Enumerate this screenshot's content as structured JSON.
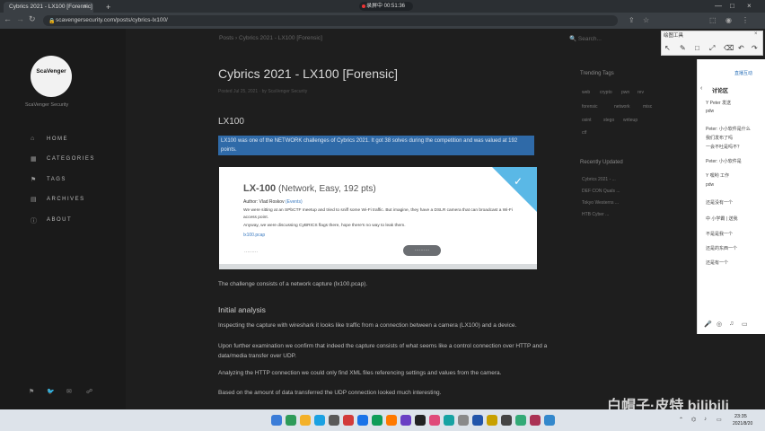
{
  "browser": {
    "tab_title": "Cybrics 2021 - LX100 [Forensic]",
    "tab_close": "×",
    "new_tab": "+",
    "recording": "录屏中 00:51:36",
    "url": "scavengersecurity.com/posts/cybrics-lx100/",
    "back": "←",
    "forward": "→",
    "reload": "↻",
    "lock": "🔒",
    "min": "—",
    "max": "□",
    "close": "×"
  },
  "site": {
    "logo_text": "ScaVenger",
    "tagline": "ScaVenger Security",
    "nav": [
      {
        "icon": "⌂",
        "label": "HOME"
      },
      {
        "icon": "▦",
        "label": "CATEGORIES"
      },
      {
        "icon": "⚑",
        "label": "TAGS"
      },
      {
        "icon": "▤",
        "label": "ARCHIVES"
      },
      {
        "icon": "ⓘ",
        "label": "ABOUT"
      }
    ],
    "social": [
      "⚑",
      "🐦",
      "✉",
      "☍"
    ]
  },
  "post": {
    "breadcrumb": "Posts › Cybrics 2021 - LX100 [Forensic]",
    "search_label": "🔍 Search...",
    "title": "Cybrics 2021 - LX100 [Forensic]",
    "meta": "Posted Jul 25, 2021 · by ScaVenger Security",
    "heading_lx100": "LX100",
    "intro": "LX100 was one of the NETWORK challenges of Cybrics 2021. It got 38 solves during the competition and was valued at 192 points.",
    "card": {
      "title_bold": "LX-100",
      "title_rest": "(Network, Easy, 192 pts)",
      "author_label": "Author: Vlad Roskov",
      "author_link": "(Events)",
      "desc1": "We were sitting at an SPbCTF meetup and tried to sniff some Wi-Fi traffic. But imagine, they have a DSLR camera that can broadcast a Wi-Fi access point.",
      "desc2": "Anyway, we were discussing CyBRICS flags there, hope there's no way to leak them.",
      "link": "lx100.pcap",
      "left_label": "  ·········",
      "button": "··········",
      "check": "✓"
    },
    "p_challenge": "The challenge consists of a network capture (lx100.pcap).",
    "heading_initial": "Initial analysis",
    "paragraphs": [
      "Inspecting the capture with wireshark it looks like traffic from a connection between a camera (LX100) and a device.",
      "Upon further examination we confirm that indeed the capture consists of what seems like a control connection over HTTP and a data/media transfer over UDP.",
      "Analyzing the HTTP connection we could only find XML files referencing settings and values from the camera.",
      "Based on the amount of data transferred the UDP connection looked much interesting."
    ]
  },
  "right_sidebar": {
    "trending_title": "Trending Tags",
    "tags": [
      "web",
      "crypto",
      "pwn",
      "rev",
      "forensic",
      "network",
      "misc",
      "osint",
      "stego",
      "writeup",
      "ctf"
    ],
    "recent_title": "Recently Updated",
    "recent": [
      "Cybrics 2021 - ...",
      "DEF CON Quals ...",
      "Tokyo Westerns ...",
      "HTB Cyber ..."
    ]
  },
  "toolbox": {
    "title": "绘图工具",
    "close": "×",
    "icons": [
      "↖",
      "✎",
      "□",
      "⤢",
      "⌫",
      "↶",
      "↷"
    ]
  },
  "chat": {
    "tab": "直播互动",
    "title": "讨论区",
    "back": "‹",
    "lines": [
      "Y Peter 发送",
      "pdw",
      "Peter: 小小软件是什么",
      "我们发布了吗",
      "一会不吐是吗不？",
      "Peter: 小小软件是",
      "Y 嘿哟 工作",
      "pdw",
      "还是没有一个",
      "中 小学霸 | 送我",
      "不是是我一个",
      "还是的东西一个",
      "还是有一个"
    ],
    "bottom_icons": [
      "🎤",
      "◎",
      "♫",
      "▭"
    ]
  },
  "taskbar": {
    "time": "23:35",
    "date": "2021/8/20",
    "apps": [
      "#3b7dd8",
      "#2e9b59",
      "#f3b12a",
      "#1ba1e2",
      "#5a5a5a",
      "#d23b3b",
      "#1a73e8",
      "#0f9d58",
      "#ff7a00",
      "#6a3fc4",
      "#222222",
      "#e04a7a",
      "#18a3a3",
      "#8a8a8a",
      "#2255aa",
      "#c8a000",
      "#444444",
      "#33aa77",
      "#aa3355",
      "#3388cc"
    ]
  },
  "watermark": "白帽子·皮特 bilibili"
}
